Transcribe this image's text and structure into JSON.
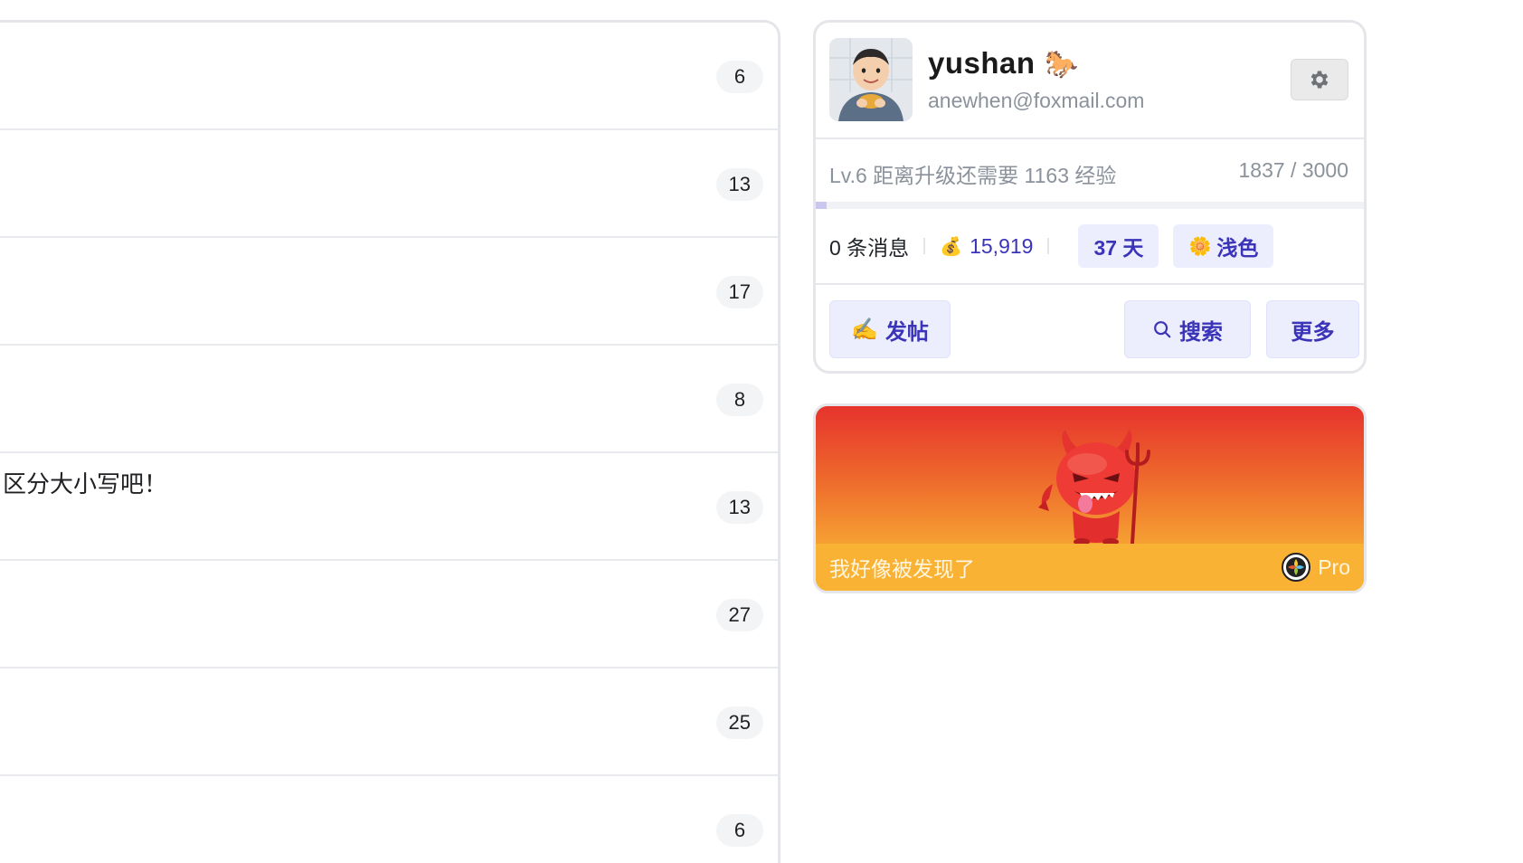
{
  "topics": [
    {
      "title": "",
      "replies": "6"
    },
    {
      "title": "",
      "replies": "13"
    },
    {
      "title": "",
      "replies": "17"
    },
    {
      "title": "",
      "replies": "8"
    },
    {
      "title": "区分大小写吧！",
      "replies": "13"
    },
    {
      "title": "",
      "replies": "27"
    },
    {
      "title": "",
      "replies": "25"
    },
    {
      "title": "",
      "replies": "6"
    }
  ],
  "user": {
    "name": "yushan",
    "badge_icon": "horse-icon",
    "email": "anewhen@foxmail.com",
    "level_text": "Lv.6 距离升级还需要 1163 经验",
    "exp_text": "1837 / 3000",
    "exp_progress": 0.02,
    "messages": "0 条消息",
    "coins": "15,919",
    "days": "37 天",
    "theme": "浅色",
    "settings_icon": "gear-icon"
  },
  "actions": {
    "post": "发帖",
    "search": "搜索",
    "more": "更多"
  },
  "banner": {
    "caption": "我好像被发现了",
    "tag": "Pro"
  },
  "colors": {
    "accent": "#3b34b8",
    "pill_bg": "#eceefe",
    "banner_top": "#e6332d",
    "banner_bottom": "#f8b432"
  }
}
